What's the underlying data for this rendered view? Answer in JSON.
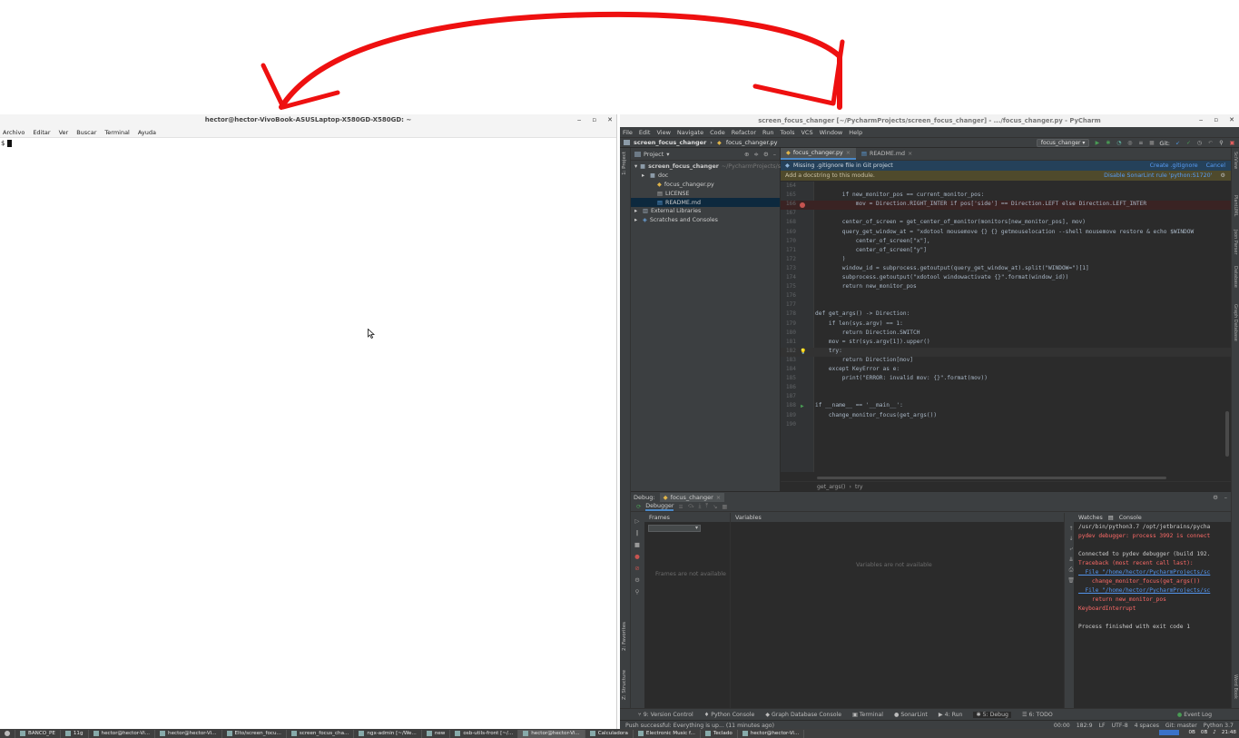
{
  "terminal": {
    "title": "hector@hector-VivoBook-ASUSLaptop-X580GD-X580GD: ~",
    "window_controls": [
      "‒",
      "▫",
      "✕"
    ],
    "menu": [
      "Archivo",
      "Editar",
      "Ver",
      "Buscar",
      "Terminal",
      "Ayuda"
    ],
    "prompt": "$"
  },
  "pycharm": {
    "title": "screen_focus_changer [~/PycharmProjects/screen_focus_changer] - .../focus_changer.py - PyCharm",
    "window_controls": [
      "‒",
      "▫",
      "✕"
    ],
    "menu": [
      "File",
      "Edit",
      "View",
      "Navigate",
      "Code",
      "Refactor",
      "Run",
      "Tools",
      "VCS",
      "Window",
      "Help"
    ],
    "nav_project": "screen_focus_changer",
    "nav_file": "focus_changer.py",
    "run_config": "focus_changer",
    "git_label": "Git:",
    "left_strip": [
      "1: Project",
      "2: Favorites",
      "Z: Structure"
    ],
    "right_strip": [
      "SciView",
      "PlantUML",
      "Json Parser",
      "Database",
      "Graph Database",
      "Word Book"
    ],
    "project_panel": {
      "title": "Project",
      "tree": [
        {
          "label": "screen_focus_changer",
          "suffix": "~/PycharmProjects/screen_focus_changer",
          "icon": "folder-icon",
          "indent": 0,
          "arrow": "▾",
          "bold": true
        },
        {
          "label": "doc",
          "suffix": "",
          "icon": "folder-icon",
          "indent": 1,
          "arrow": "▸",
          "bold": false
        },
        {
          "label": "focus_changer.py",
          "suffix": "",
          "icon": "python-file-icon",
          "indent": 2,
          "arrow": "",
          "bold": false
        },
        {
          "label": "LICENSE",
          "suffix": "",
          "icon": "text-file-icon",
          "indent": 2,
          "arrow": "",
          "bold": false
        },
        {
          "label": "README.md",
          "suffix": "",
          "icon": "markdown-file-icon",
          "indent": 2,
          "arrow": "",
          "bold": false,
          "selected": true
        },
        {
          "label": "External Libraries",
          "suffix": "",
          "icon": "library-icon",
          "indent": 0,
          "arrow": "▸",
          "bold": false
        },
        {
          "label": "Scratches and Consoles",
          "suffix": "",
          "icon": "scratch-icon",
          "indent": 0,
          "arrow": "▸",
          "bold": false
        }
      ]
    },
    "tabs": [
      {
        "label": "focus_changer.py",
        "active": true
      },
      {
        "label": "README.md",
        "active": false
      }
    ],
    "git_banner": {
      "text": "Missing .gitignore file in Git project",
      "actions": [
        "Create .gitignore",
        "Cancel"
      ]
    },
    "sonar_banner": {
      "text": "Add a docstring to this module.",
      "action": "Disable SonarLint rule 'python:S1720'"
    },
    "code": [
      {
        "n": "164",
        "text": ""
      },
      {
        "n": "165",
        "text": "        if new_monitor_pos == current_monitor_pos:"
      },
      {
        "n": "166",
        "text": "            mov = Direction.RIGHT_INTER if pos['side'] == Direction.LEFT else Direction.LEFT_INTER",
        "mark": "breakpoint"
      },
      {
        "n": "167",
        "text": ""
      },
      {
        "n": "168",
        "text": "        center_of_screen = get_center_of_monitor(monitors[new_monitor_pos], mov)"
      },
      {
        "n": "169",
        "text": "        query_get_window_at = \"xdotool mousemove {} {} getmouselocation --shell mousemove restore & echo $WINDOW"
      },
      {
        "n": "170",
        "text": "            center_of_screen[\"x\"],"
      },
      {
        "n": "171",
        "text": "            center_of_screen[\"y\"]"
      },
      {
        "n": "172",
        "text": "        )"
      },
      {
        "n": "173",
        "text": "        window_id = subprocess.getoutput(query_get_window_at).split(\"WINDOW=\")[1]"
      },
      {
        "n": "174",
        "text": "        subprocess.getoutput(\"xdotool windowactivate {}\".format(window_id))"
      },
      {
        "n": "175",
        "text": "        return new_monitor_pos"
      },
      {
        "n": "176",
        "text": ""
      },
      {
        "n": "177",
        "text": ""
      },
      {
        "n": "178",
        "text": "def get_args() -> Direction:"
      },
      {
        "n": "179",
        "text": "    if len(sys.argv) == 1:"
      },
      {
        "n": "180",
        "text": "        return Direction.SWITCH"
      },
      {
        "n": "181",
        "text": "    mov = str(sys.argv[1]).upper()"
      },
      {
        "n": "182",
        "text": "    try:",
        "mark": "bulb"
      },
      {
        "n": "183",
        "text": "        return Direction[mov]"
      },
      {
        "n": "184",
        "text": "    except KeyError as e:"
      },
      {
        "n": "185",
        "text": "        print(\"ERROR: invalid mov: {}\".format(mov))"
      },
      {
        "n": "186",
        "text": ""
      },
      {
        "n": "187",
        "text": ""
      },
      {
        "n": "188",
        "text": "if __name__ == '__main__':",
        "mark": "run"
      },
      {
        "n": "189",
        "text": "    change_monitor_focus(get_args())"
      },
      {
        "n": "190",
        "text": ""
      }
    ],
    "editor_breadcrumb": [
      "get_args()",
      "try"
    ],
    "debug": {
      "label": "Debug:",
      "config": "focus_changer",
      "subtabs": [
        "Debugger"
      ],
      "frames_title": "Frames",
      "frames_empty": "Frames are not available",
      "variables_title": "Variables",
      "variables_empty": "Variables are not available",
      "console_tabs": [
        "Watches",
        "Console"
      ],
      "console": [
        {
          "t": "/usr/bin/python3.7 /opt/jetbrains/pycha",
          "k": "plain"
        },
        {
          "t": "pydev debugger: process 3992 is connect",
          "k": "err"
        },
        {
          "t": "",
          "k": "plain"
        },
        {
          "t": "Connected to pydev debugger (build 192.",
          "k": "plain"
        },
        {
          "t": "Traceback (most recent call last):",
          "k": "err"
        },
        {
          "t": "  File \"/home/hector/PycharmProjects/sc",
          "k": "link"
        },
        {
          "t": "    change_monitor_focus(get_args())",
          "k": "err"
        },
        {
          "t": "  File \"/home/hector/PycharmProjects/sc",
          "k": "link"
        },
        {
          "t": "    return new_monitor_pos",
          "k": "err"
        },
        {
          "t": "KeyboardInterrupt",
          "k": "err"
        },
        {
          "t": "",
          "k": "plain"
        },
        {
          "t": "Process finished with exit code 1",
          "k": "plain"
        }
      ]
    },
    "bottom_tools": [
      {
        "label": "9: Version Control",
        "active": false
      },
      {
        "label": "Python Console",
        "active": false
      },
      {
        "label": "Graph Database Console",
        "active": false
      },
      {
        "label": "Terminal",
        "active": false
      },
      {
        "label": "SonarLint",
        "active": false
      },
      {
        "label": "4: Run",
        "active": false
      },
      {
        "label": "5: Debug",
        "active": true
      },
      {
        "label": "6: TODO",
        "active": false
      }
    ],
    "event_log": "Event Log",
    "status_left": "Push successful: Everything is up... (11 minutes ago)",
    "status_right": [
      "00:00",
      "182:9",
      "LF",
      "UTF-8",
      "4 spaces",
      "Git: master",
      "Python 3.7"
    ]
  },
  "taskbar": {
    "tasks": [
      {
        "label": "BANCO_PE",
        "active": false
      },
      {
        "label": "11g",
        "active": false
      },
      {
        "label": "hector@hector-Vi...",
        "active": false
      },
      {
        "label": "hector@hector-Vi...",
        "active": false
      },
      {
        "label": "Elto/screen_focu...",
        "active": false
      },
      {
        "label": "screen_focus_cha...",
        "active": false
      },
      {
        "label": "ngx-admin [~/We...",
        "active": false
      },
      {
        "label": "new",
        "active": false
      },
      {
        "label": "osb-utils-front [~/...",
        "active": false
      },
      {
        "label": "hector@hector-Vi...",
        "active": true
      },
      {
        "label": "Calculadora",
        "active": false
      },
      {
        "label": "Electronic Music f...",
        "active": false
      },
      {
        "label": "Teclado",
        "active": false
      },
      {
        "label": "hector@hector-Vi...",
        "active": false
      }
    ],
    "tray": [
      "0B",
      "0B",
      "21:48"
    ]
  }
}
